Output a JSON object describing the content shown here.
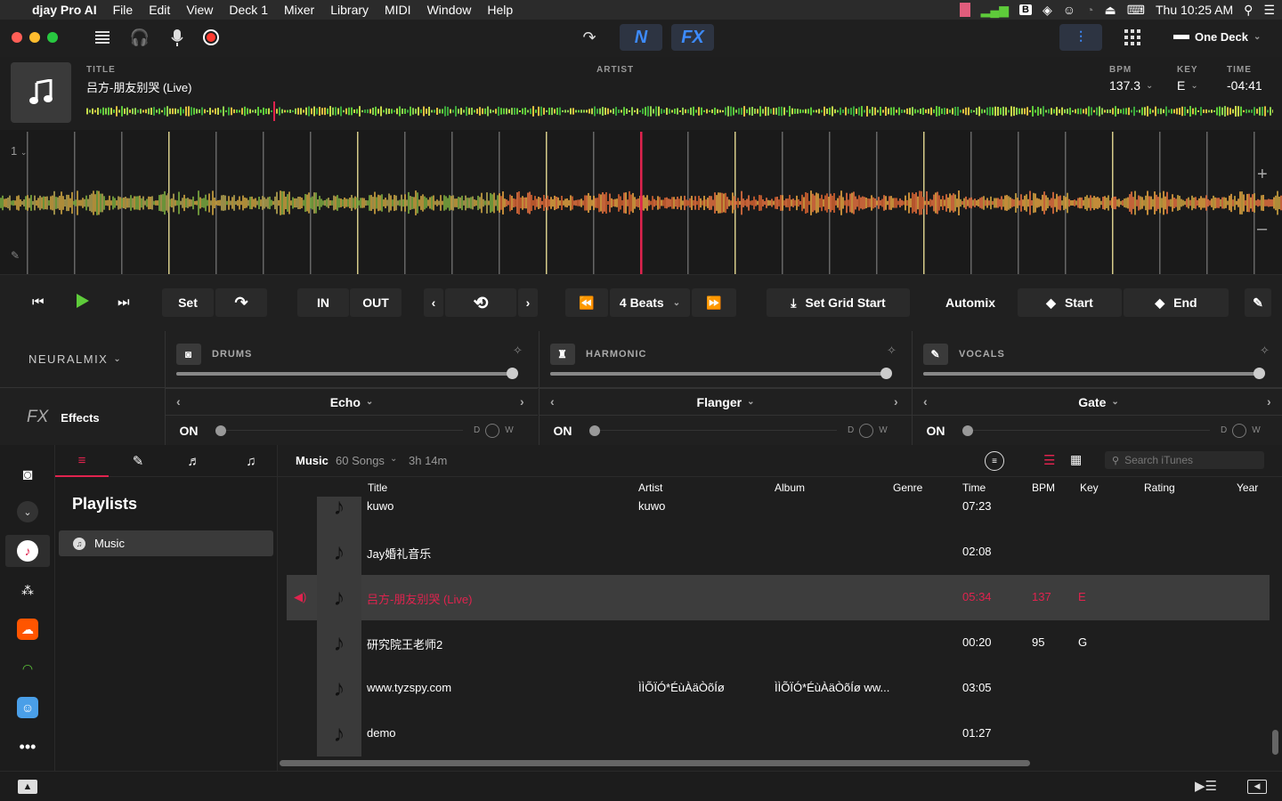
{
  "menubar": {
    "app": "djay Pro AI",
    "items": [
      "File",
      "Edit",
      "View",
      "Deck 1",
      "Mixer",
      "Library",
      "MIDI",
      "Window",
      "Help"
    ],
    "clock": "Thu 10:25 AM"
  },
  "toolbar": {
    "n_label": "N",
    "fx_label": "FX",
    "deck_mode": "One Deck"
  },
  "track": {
    "title_label": "TITLE",
    "title": "吕方-朋友别哭 (Live)",
    "artist_label": "ARTIST",
    "artist": "",
    "bpm_label": "BPM",
    "bpm": "137.3",
    "key_label": "KEY",
    "key": "E",
    "time_label": "TIME",
    "time": "-04:41"
  },
  "waveform": {
    "deck_number": "1",
    "playhead_position": 0.5
  },
  "controls": {
    "set": "Set",
    "in": "IN",
    "out": "OUT",
    "loop_length": "4",
    "beats": "4 Beats",
    "set_grid_start": "Set Grid Start",
    "automix": "Automix",
    "start": "Start",
    "end": "End"
  },
  "neuralmix": {
    "logo": "NEURALMIX",
    "effects_label": "Effects",
    "stems": [
      {
        "name": "DRUMS",
        "fx": "Echo",
        "on": "ON",
        "level": 1.0
      },
      {
        "name": "HARMONIC",
        "fx": "Flanger",
        "on": "ON",
        "level": 1.0
      },
      {
        "name": "VOCALS",
        "fx": "Gate",
        "on": "ON",
        "level": 1.0
      }
    ],
    "dry": "D",
    "wet": "W"
  },
  "library": {
    "source": "Music",
    "count": "60 Songs",
    "duration": "3h 14m",
    "search_placeholder": "Search iTunes",
    "sidebar_title": "Playlists",
    "selected_playlist": "Music",
    "columns": [
      "Title",
      "Artist",
      "Album",
      "Genre",
      "Time",
      "BPM",
      "Key",
      "Rating",
      "Year"
    ],
    "rows": [
      {
        "title": "kuwo",
        "artist": "kuwo",
        "album": "",
        "time": "07:23",
        "bpm": "",
        "key": ""
      },
      {
        "title": "Jay婚礼音乐",
        "artist": "",
        "album": "",
        "time": "02:08",
        "bpm": "",
        "key": ""
      },
      {
        "title": "吕方-朋友别哭 (Live)",
        "artist": "",
        "album": "",
        "time": "05:34",
        "bpm": "137",
        "key": "E"
      },
      {
        "title": "研究院王老师2",
        "artist": "",
        "album": "",
        "time": "00:20",
        "bpm": "95",
        "key": "G"
      },
      {
        "title": "www.tyzspy.com",
        "artist": "ÌÌÕÏÓ*ÉùÀäÒõÍø",
        "album": "ÌÌÕÏÓ*ÉùÀäÒõÍø ww...",
        "time": "03:05",
        "bpm": "",
        "key": ""
      },
      {
        "title": "demo",
        "artist": "",
        "album": "",
        "time": "01:27",
        "bpm": "",
        "key": ""
      }
    ]
  },
  "colors": {
    "accent_blue": "#3d8bff",
    "playing_red": "#e0234e",
    "play_green": "#5ecb3a",
    "record_red": "#ff3b30"
  }
}
